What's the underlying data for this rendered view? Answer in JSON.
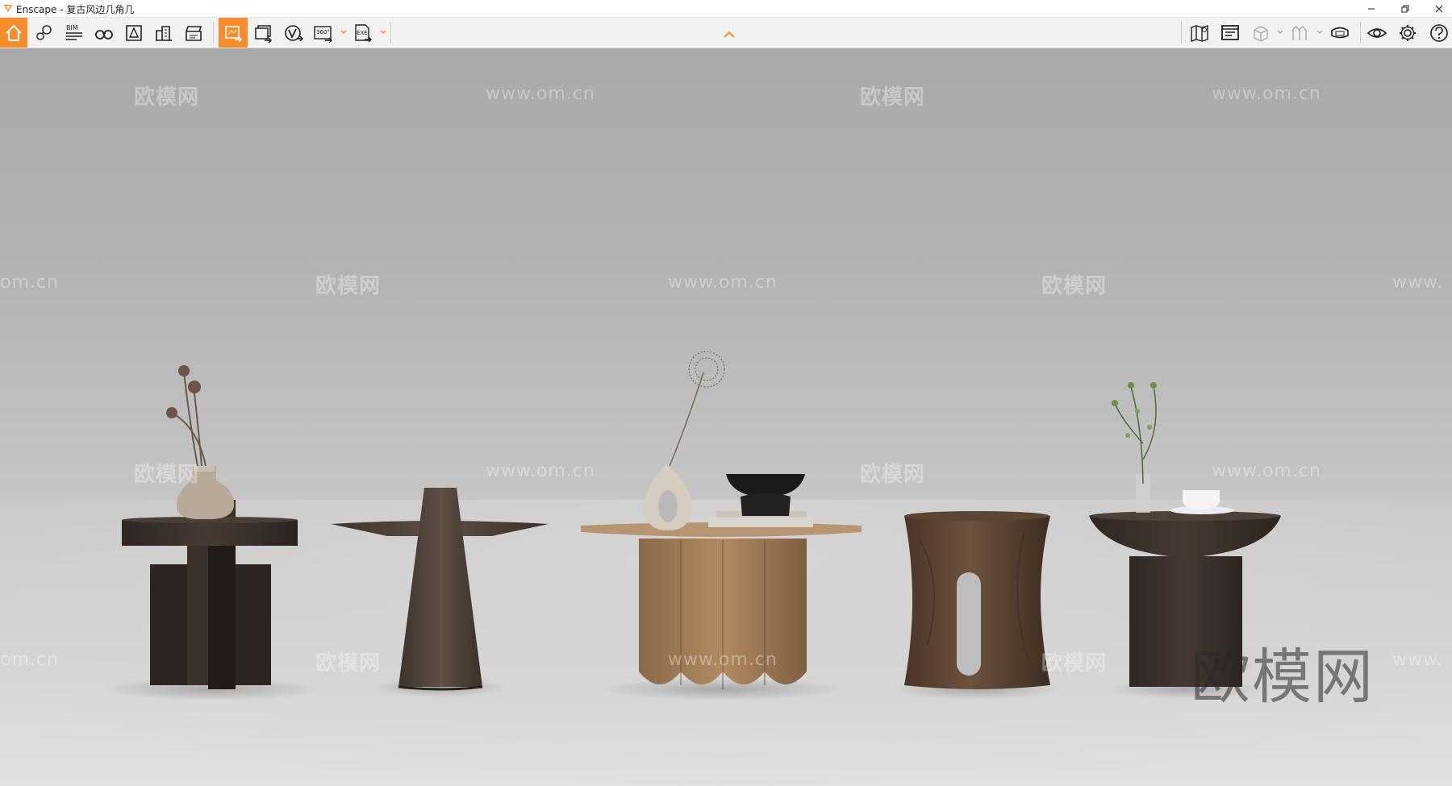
{
  "window": {
    "title": "Enscape - 复古风边几角几",
    "controls": [
      "minimize",
      "restore",
      "close"
    ]
  },
  "toolbar": {
    "left_tools": [
      {
        "icon": "home-icon",
        "active": true
      },
      {
        "icon": "location-pin-icon"
      },
      {
        "icon": "bim-icon",
        "label": "BIM"
      },
      {
        "icon": "binoculars-icon"
      },
      {
        "icon": "asset-library-icon"
      },
      {
        "icon": "buildings-icon"
      },
      {
        "icon": "clapperboard-icon"
      },
      {
        "icon": "render-screenshot-icon",
        "active": true
      },
      {
        "icon": "batch-render-icon"
      },
      {
        "icon": "vr-export-icon"
      },
      {
        "icon": "panorama-360-icon",
        "label": "360°"
      },
      {
        "icon": "export-exe-icon",
        "label": "EXE"
      }
    ],
    "collapse_arrow": "chevron-up-icon",
    "right_tools": [
      {
        "icon": "map-icon"
      },
      {
        "icon": "window-icon"
      },
      {
        "icon": "cube-icon"
      },
      {
        "icon": "chart-icon"
      },
      {
        "icon": "headset-icon"
      },
      {
        "icon": "eye-icon"
      },
      {
        "icon": "gear-icon"
      },
      {
        "icon": "help-icon"
      }
    ],
    "accent_color": "#f78c2b"
  },
  "viewport": {
    "watermark_text": "欧模网",
    "watermark_url": "www.om.cn",
    "watermark_url_partial": "om.cn",
    "watermark_url_cut": "www.",
    "big_watermark": "欧模网"
  }
}
